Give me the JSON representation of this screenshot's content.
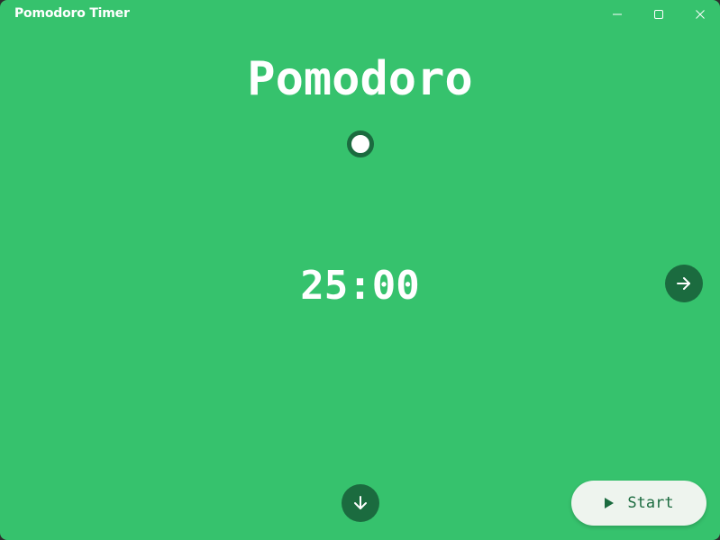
{
  "window": {
    "title": "Pomodoro Timer",
    "controls": {
      "minimize_icon": "minimize-icon",
      "maximize_icon": "maximize-icon",
      "close_icon": "close-icon"
    }
  },
  "timer": {
    "mode": "Pomodoro",
    "time": "25:00",
    "indicator_color": "#1b6b3f"
  },
  "buttons": {
    "next_icon": "arrow-right-icon",
    "expand_icon": "arrow-down-icon",
    "start_label": "Start",
    "start_icon": "play-icon"
  },
  "colors": {
    "background": "#36c26d",
    "accent_dark": "#1b6b3f",
    "start_button_bg": "#eef4ee",
    "text": "#ffffff"
  }
}
